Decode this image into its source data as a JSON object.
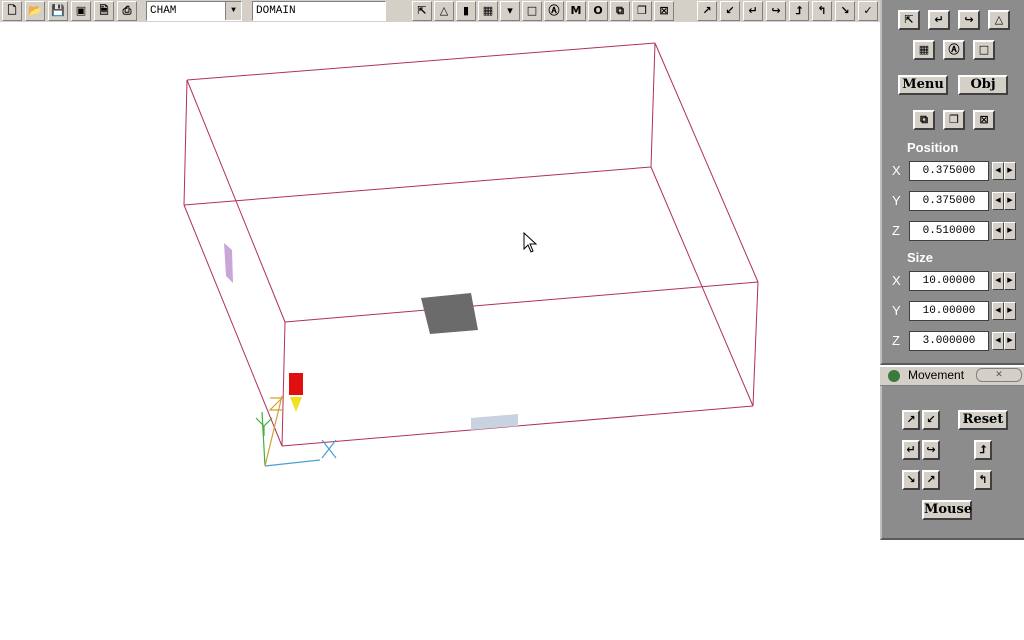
{
  "toolbar": {
    "file_buttons": [
      {
        "name": "new-file-icon",
        "glyph": "🗋"
      },
      {
        "name": "open-folder-icon",
        "glyph": "📂"
      },
      {
        "name": "save-icon",
        "glyph": "💾"
      },
      {
        "name": "image-icon",
        "glyph": "▣"
      },
      {
        "name": "document-icon",
        "glyph": "🗎"
      },
      {
        "name": "print-icon",
        "glyph": "⎙"
      }
    ],
    "application_combo": "CHAM",
    "object_field": "DOMAIN",
    "view_buttons": [
      {
        "name": "axes-icon",
        "glyph": "⇱"
      },
      {
        "name": "cone-icon",
        "glyph": "△"
      },
      {
        "name": "red-probe-icon",
        "glyph": "▮"
      },
      {
        "name": "grid-icon",
        "glyph": "▦"
      },
      {
        "name": "grid-dropdown-icon",
        "glyph": "▾"
      },
      {
        "name": "box-outline-icon",
        "glyph": "□"
      },
      {
        "name": "object-icon",
        "glyph": "Ⓐ"
      },
      {
        "name": "mesh-icon",
        "glyph": "M"
      },
      {
        "name": "outline-icon",
        "glyph": "O"
      },
      {
        "name": "shrink-icon",
        "glyph": "⧉"
      },
      {
        "name": "duplicate-icon",
        "glyph": "❐"
      },
      {
        "name": "delete-object-icon",
        "glyph": "⊠"
      }
    ],
    "rotate_buttons": [
      {
        "name": "rotate-up-right-icon",
        "glyph": "↗"
      },
      {
        "name": "rotate-down-left-icon",
        "glyph": "↙"
      },
      {
        "name": "rotate-left-icon",
        "glyph": "↵"
      },
      {
        "name": "rotate-right-icon",
        "glyph": "↪"
      },
      {
        "name": "rotate-up-icon",
        "glyph": "⮥"
      },
      {
        "name": "rotate-back-icon",
        "glyph": "↰"
      },
      {
        "name": "rotate-diag-down-icon",
        "glyph": "↘"
      },
      {
        "name": "rotate-diag-check-icon",
        "glyph": "✓"
      }
    ]
  },
  "panel": {
    "top_buttons": [
      {
        "name": "axes-icon",
        "glyph": "⇱"
      },
      {
        "name": "rotate-left-icon",
        "glyph": "↵"
      },
      {
        "name": "rotate-right-icon",
        "glyph": "↪"
      },
      {
        "name": "cone-icon",
        "glyph": "△"
      }
    ],
    "second_buttons": [
      {
        "name": "grid-icon",
        "glyph": "▦"
      },
      {
        "name": "object-icon",
        "glyph": "Ⓐ"
      },
      {
        "name": "box-outline-icon",
        "glyph": "□"
      }
    ],
    "menu_label": "Menu",
    "obj_label": "Obj",
    "tool_buttons": [
      {
        "name": "shrink-icon",
        "glyph": "⧉"
      },
      {
        "name": "duplicate-icon",
        "glyph": "❐"
      },
      {
        "name": "delete-object-icon",
        "glyph": "⊠"
      }
    ],
    "position_label": "Position",
    "position": [
      {
        "axis": "X",
        "value": "0.375000"
      },
      {
        "axis": "Y",
        "value": "0.375000"
      },
      {
        "axis": "Z",
        "value": "0.510000"
      }
    ],
    "size_label": "Size",
    "size": [
      {
        "axis": "X",
        "value": "10.00000"
      },
      {
        "axis": "Y",
        "value": "10.00000"
      },
      {
        "axis": "Z",
        "value": "3.000000"
      }
    ]
  },
  "movement": {
    "title": "Movement",
    "reset_label": "Reset",
    "mouse_label": "Mouse"
  }
}
